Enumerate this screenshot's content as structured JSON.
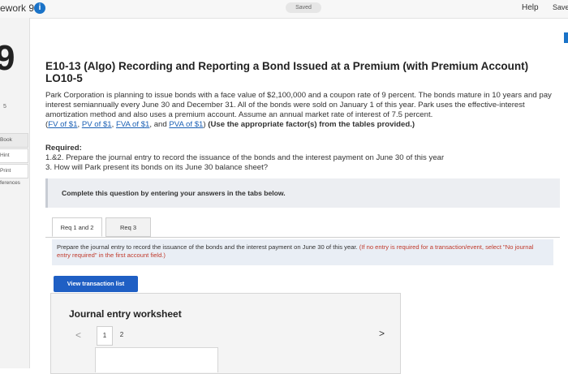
{
  "header": {
    "title": "ework 9",
    "info_icon": "i",
    "saved": "Saved",
    "help": "Help",
    "save": "Save"
  },
  "sidebar": {
    "question_number": "9",
    "side_label": "5",
    "book": "Book",
    "hint": "Hint",
    "print": "Print",
    "references": "ferences"
  },
  "question": {
    "title": "E10-13 (Algo) Recording and Reporting a Bond Issued at a Premium (with Premium Account) LO10-5",
    "problem_text": "Park Corporation is planning to issue bonds with a face value of $2,100,000 and a coupon rate of 9 percent. The bonds mature in 10 years and pay interest semiannually every June 30 and December 31. All of the bonds were sold on January 1 of this year. Park uses the effective-interest amortization method and also uses a premium account. Assume an annual market rate of interest of 7.5 percent.",
    "links": {
      "fv": "FV of $1",
      "pv": "PV of $1",
      "fva": "FVA of $1",
      "pva": "PVA of $1"
    },
    "factor_note": "(Use the appropriate factor(s) from the tables provided.)",
    "required_label": "Required:",
    "req1": "1.&2. Prepare the journal entry to record the issuance of the bonds and the interest payment on June 30 of this year",
    "req3": "3. How will Park present its bonds on its June 30 balance sheet?"
  },
  "complete_prompt": "Complete this question by entering your answers in the tabs below.",
  "tabs": [
    {
      "label": "Req 1 and 2"
    },
    {
      "label": "Req 3"
    }
  ],
  "instructions": {
    "main": "Prepare the journal entry to record the issuance of the bonds and the interest payment on June 30 of this year.",
    "red": "(If no entry is required for a transaction/event, select \"No journal entry required\" in the first account field.)"
  },
  "view_button": "View transaction list",
  "worksheet": {
    "title": "Journal entry worksheet",
    "pages": [
      "1",
      "2"
    ],
    "prev": "<",
    "next": ">"
  },
  "colors": {
    "accent": "#1f5fc4",
    "link": "#1a5fb4",
    "warning_text": "#c0392b"
  }
}
